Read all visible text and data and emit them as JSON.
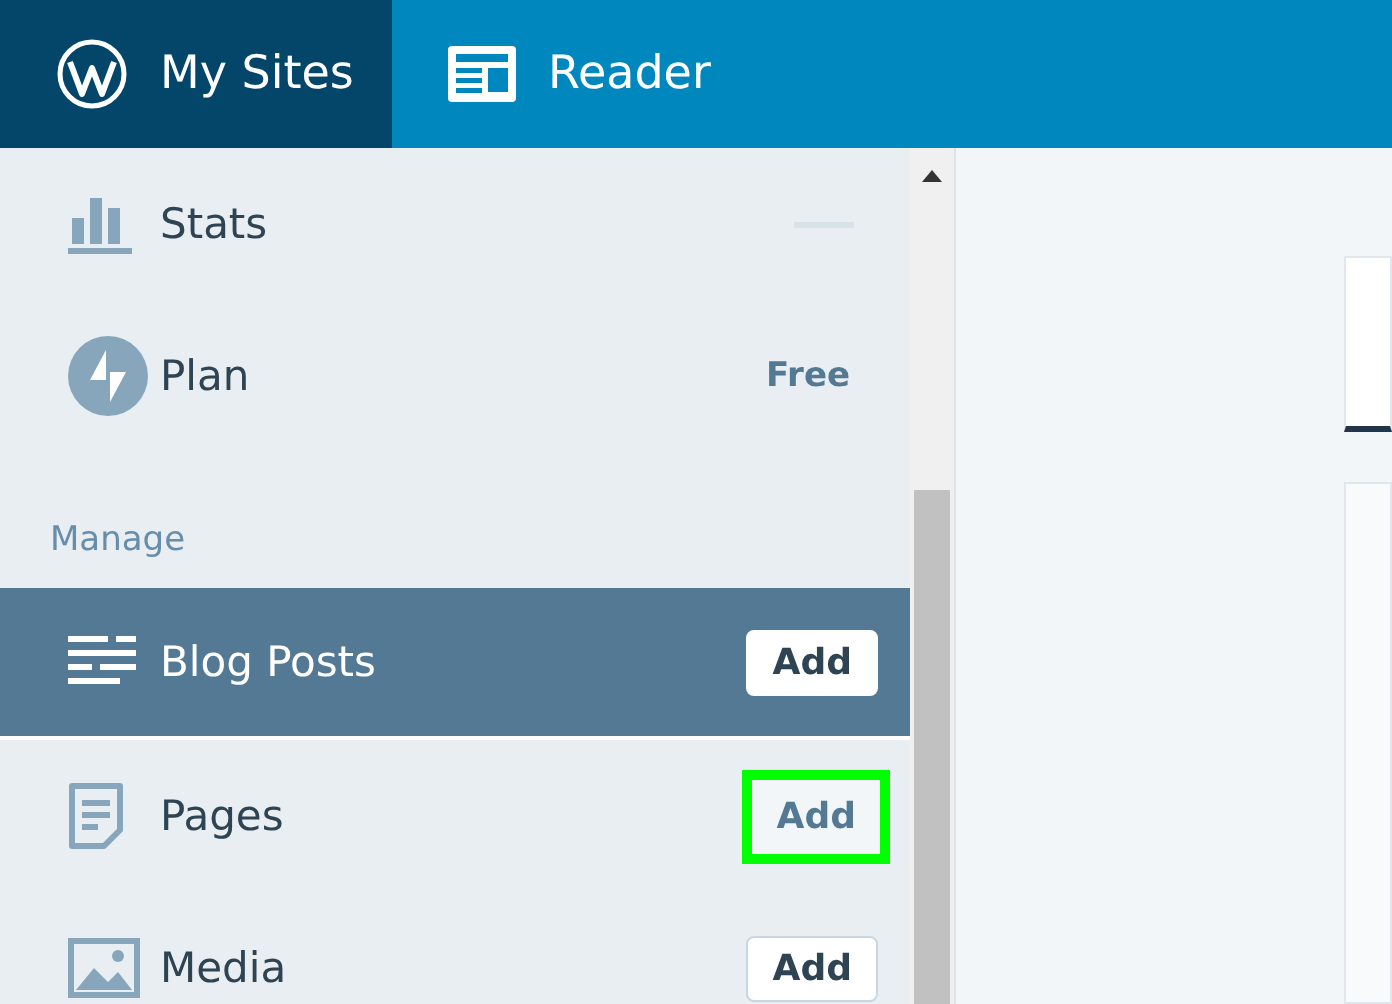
{
  "top_bar": {
    "tabs": [
      {
        "label": "My Sites",
        "selected": true
      },
      {
        "label": "Reader",
        "selected": false
      }
    ]
  },
  "sidebar": {
    "items": [
      {
        "kind": "item",
        "label": "Stats",
        "selected": false,
        "loading": true
      },
      {
        "kind": "item",
        "label": "Plan",
        "selected": false,
        "badge": "Free"
      },
      {
        "kind": "header",
        "label": "Manage"
      },
      {
        "kind": "item",
        "label": "Blog Posts",
        "selected": true,
        "button": {
          "label": "Add",
          "highlighted": false
        }
      },
      {
        "kind": "item",
        "label": "Pages",
        "selected": false,
        "button": {
          "label": "Add",
          "highlighted": true
        }
      },
      {
        "kind": "item",
        "label": "Media",
        "selected": false,
        "button": {
          "label": "Add",
          "highlighted": false
        }
      }
    ]
  }
}
